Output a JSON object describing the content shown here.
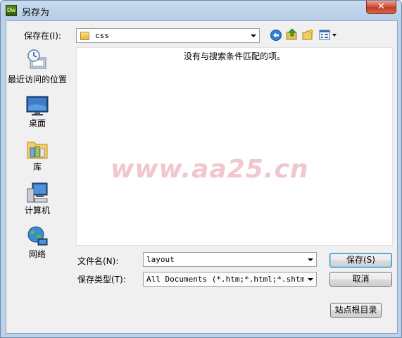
{
  "window": {
    "title": "另存为",
    "app_icon_text": "Dw",
    "close_label": "✕"
  },
  "toolbar": {
    "save_in_label": "保存在(I):",
    "save_in_value": "css",
    "icons": [
      "back-icon",
      "up-folder-icon",
      "new-folder-icon",
      "views-menu-icon"
    ]
  },
  "places": [
    {
      "label": "最近访问的位置",
      "icon": "recent-places-icon"
    },
    {
      "label": "桌面",
      "icon": "desktop-icon"
    },
    {
      "label": "库",
      "icon": "libraries-icon"
    },
    {
      "label": "计算机",
      "icon": "computer-icon"
    },
    {
      "label": "网络",
      "icon": "network-icon"
    }
  ],
  "file_list": {
    "empty_message": "没有与搜索条件匹配的项。",
    "watermark": "www.aa25.cn"
  },
  "form": {
    "filename_label": "文件名(N):",
    "filename_value": "layout",
    "filetype_label": "保存类型(T):",
    "filetype_value": "All Documents (*.htm;*.html;*.shtm;*."
  },
  "buttons": {
    "save": "保存(S)",
    "cancel": "取消",
    "site_root": "站点根目录"
  },
  "colors": {
    "title_bar": "#c9dbef",
    "close_button": "#c13d24",
    "dialog_face": "#f0f0f0",
    "watermark": "#f0c6cf"
  }
}
